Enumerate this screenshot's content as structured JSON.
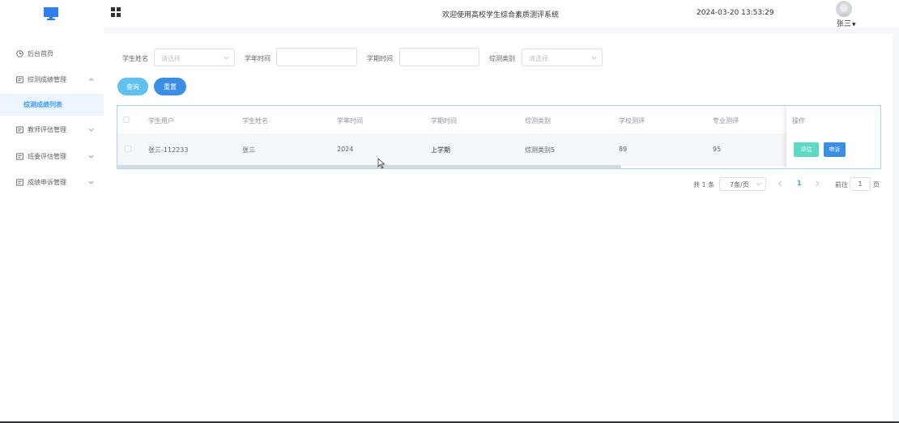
{
  "header": {
    "welcome": "欢迎使用高校学生综合素质测评系统",
    "datetime": "2024-03-20 13:53:29",
    "username": "张三"
  },
  "sidebar": {
    "items": [
      {
        "label": "后台首页"
      },
      {
        "label": "综测成绩管理",
        "expanded": true,
        "children": [
          {
            "label": "综测成绩列表",
            "active": true
          }
        ]
      },
      {
        "label": "教师评估管理"
      },
      {
        "label": "班委评估管理"
      },
      {
        "label": "成绩申诉管理"
      }
    ]
  },
  "filters": {
    "student_name_label": "学生姓名",
    "student_name_placeholder": "请选择",
    "year_label": "学年时间",
    "year_value": "",
    "term_label": "学期时间",
    "term_value": "",
    "category_label": "综测类别",
    "category_placeholder": "请选择",
    "query_label": "查询",
    "reset_label": "重置"
  },
  "table": {
    "headers": [
      "学生用户",
      "学生姓名",
      "学年时间",
      "学期时间",
      "综测类别",
      "学校测评",
      "专业测评",
      "操作"
    ],
    "rows": [
      [
        "张三-112233",
        "张三",
        "2024",
        "上学期",
        "综测类别5",
        "89",
        "95"
      ]
    ],
    "actions": {
      "evaluate_label": "评估",
      "appeal_label": "申诉"
    }
  },
  "pagination": {
    "total_text": "共 1 条",
    "page_size": "7条/页",
    "current_page": "1",
    "goto_label": "前往",
    "goto_value": "1",
    "page_suffix": "页"
  },
  "colors": {
    "primary": "#409eff",
    "query_button": "#5ec1f0",
    "reset_button": "#3a8ee6",
    "evaluate_button": "#5ed9c4",
    "appeal_button": "#3a8ee6"
  }
}
